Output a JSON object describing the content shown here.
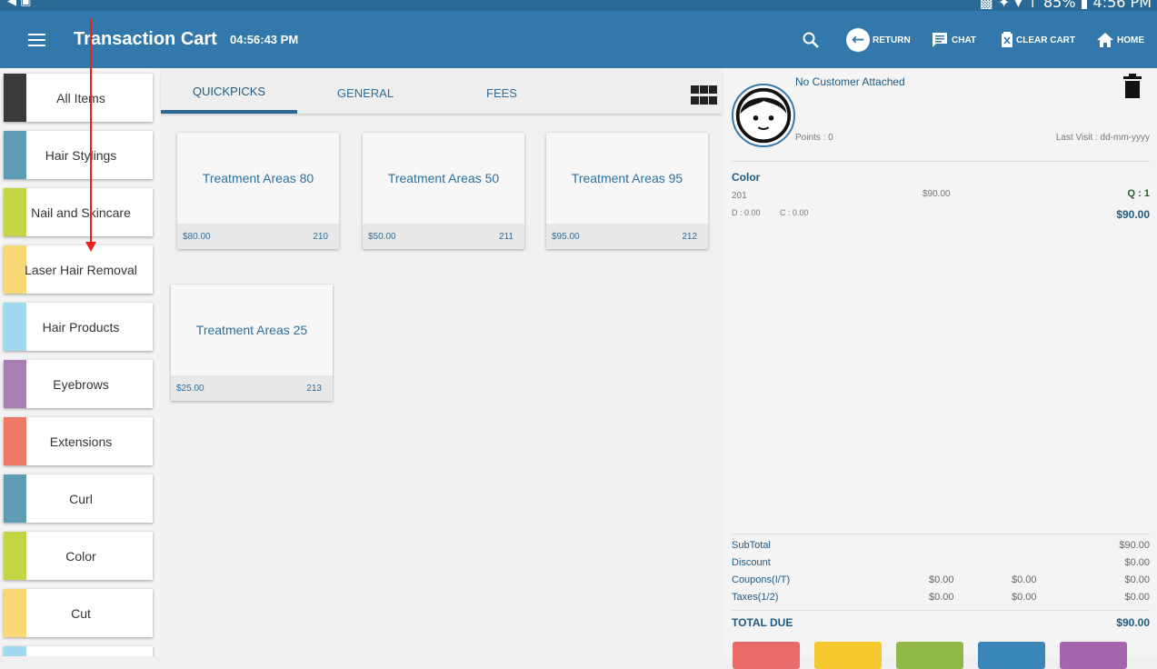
{
  "status_bar": {
    "left_icons": "◀ ▣",
    "right_text": "▩ ✦ ▾ ↑ 85% ▮ 4:56 PM"
  },
  "app_bar": {
    "title": "Transaction Cart",
    "time": "04:56:43 PM",
    "buttons": {
      "return": "RETURN",
      "chat": "CHAT",
      "clear_cart": "CLEAR CART",
      "home": "HOME"
    },
    "icons": [
      "menu-icon",
      "search-icon",
      "return-icon",
      "chat-icon",
      "clear-cart-icon",
      "home-icon"
    ]
  },
  "categories": [
    {
      "label": "All Items",
      "color": "#3a3a3a"
    },
    {
      "label": "Hair Stylings",
      "color": "#5f9cb6"
    },
    {
      "label": "Nail and Skincare",
      "color": "#c5d445"
    },
    {
      "label": "Laser Hair Removal",
      "color": "#f7d875"
    },
    {
      "label": "Hair Products",
      "color": "#9fdaf1"
    },
    {
      "label": "Eyebrows",
      "color": "#a97eb3"
    },
    {
      "label": "Extensions",
      "color": "#ee7a66"
    },
    {
      "label": "Curl",
      "color": "#5f9cb6"
    },
    {
      "label": "Color",
      "color": "#c5d445"
    },
    {
      "label": "Cut",
      "color": "#f7d875"
    },
    {
      "label": "",
      "color": "#9fdaf1"
    }
  ],
  "tabs": [
    "QUICKPICKS",
    "GENERAL",
    "FEES"
  ],
  "active_tab": "QUICKPICKS",
  "products": [
    {
      "name": "Treatment Areas 80",
      "price": "$80.00",
      "code": "210"
    },
    {
      "name": "Treatment Areas 50",
      "price": "$50.00",
      "code": "211"
    },
    {
      "name": "Treatment Areas 95",
      "price": "$95.00",
      "code": "212"
    },
    {
      "name": "Treatment Areas 25",
      "price": "$25.00",
      "code": "213"
    }
  ],
  "customer": {
    "name": "No Customer Attached",
    "points": "Points : 0",
    "last_visit": "Last Visit : dd-mm-yyyy"
  },
  "cart_item": {
    "name": "Color",
    "code": "201",
    "price": "$90.00",
    "qty": "Q : 1",
    "d": "D : 0.00",
    "c": "C : 0.00",
    "total": "$90.00"
  },
  "totals": {
    "subtotal": {
      "label": "SubTotal",
      "value": "$90.00"
    },
    "discount": {
      "label": "Discount",
      "value": "$0.00"
    },
    "coupons": {
      "label": "Coupons(I/T)",
      "v1": "$0.00",
      "v2": "$0.00",
      "value": "$0.00"
    },
    "taxes": {
      "label": "Taxes(1/2)",
      "v1": "$0.00",
      "v2": "$0.00",
      "value": "$0.00"
    },
    "total_due": {
      "label": "TOTAL DUE",
      "value": "$90.00"
    }
  },
  "payment_buttons": [
    {
      "color": "#e86a6a"
    },
    {
      "color": "#f5c92e"
    },
    {
      "color": "#8fb848"
    },
    {
      "color": "#3b86b8"
    },
    {
      "color": "#a566ad"
    }
  ],
  "colors": {
    "app_bar": "#3278aa",
    "accent": "#2a6996",
    "annotation_arrow": "#e8231f"
  }
}
